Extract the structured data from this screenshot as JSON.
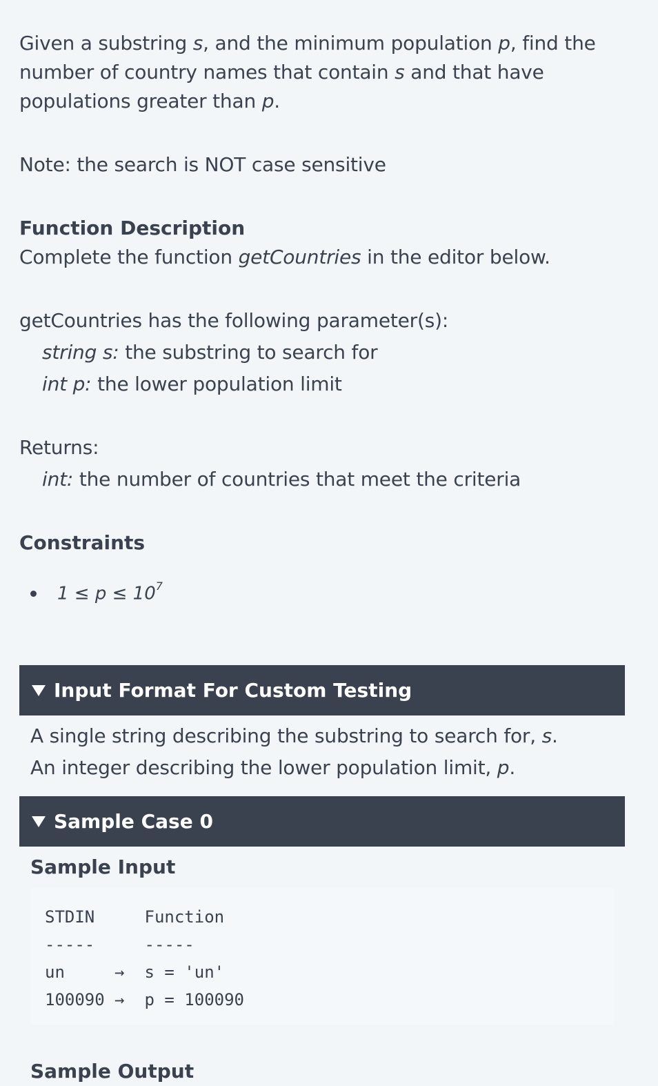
{
  "intro": {
    "p1_a": "Given a substring ",
    "p1_s": "s",
    "p1_b": ", and the minimum population ",
    "p1_p": "p",
    "p1_c": ", find the number of country names that contain ",
    "p1_s2": "s",
    "p1_d": " and that have populations greater than ",
    "p1_p2": "p",
    "p1_e": "."
  },
  "note": "Note: the search is NOT case sensitive",
  "function_description": {
    "title": "Function Description",
    "text_a": "Complete the function ",
    "fn_name": "getCountries",
    "text_b": " in the editor below."
  },
  "params": {
    "header": "getCountries has the following parameter(s):",
    "items": [
      {
        "type": "string s:",
        "desc": " the substring to search for"
      },
      {
        "type": "int p:",
        "desc": " the lower population limit"
      }
    ]
  },
  "returns": {
    "header": "Returns:",
    "type": "int:",
    "desc": " the number of countries that meet the criteria"
  },
  "constraints": {
    "title": "Constraints",
    "item_base": "1 ≤ p ≤ 10",
    "item_exp": "7"
  },
  "input_format": {
    "title": "Input Format For Custom Testing",
    "line1_a": "A single string describing the substring to search for, ",
    "line1_var": "s",
    "line1_b": ".",
    "line2_a": "An integer describing the lower population limit, ",
    "line2_var": "p",
    "line2_b": "."
  },
  "sample_case": {
    "title": "Sample Case 0",
    "input_title": "Sample Input",
    "code_lines": [
      "STDIN     Function",
      "-----     -----",
      "",
      "un     →  s = 'un'",
      "100090 →  p = 100090"
    ],
    "output_title": "Sample Output"
  }
}
